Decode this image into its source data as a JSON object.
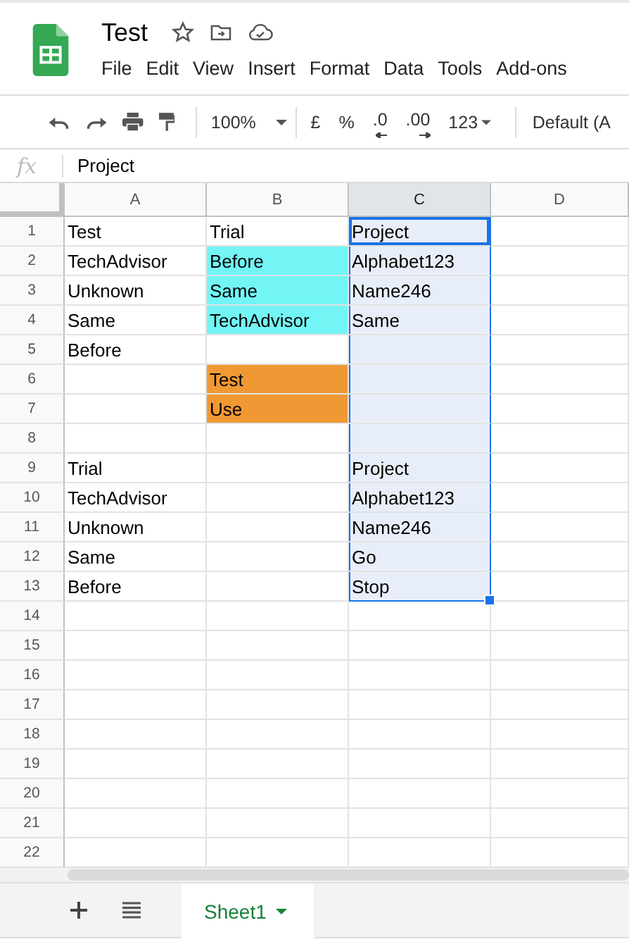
{
  "document": {
    "title": "Test"
  },
  "menu": [
    "File",
    "Edit",
    "View",
    "Insert",
    "Format",
    "Data",
    "Tools",
    "Add-ons"
  ],
  "toolbar": {
    "zoom": "100%",
    "currency": "£",
    "percent": "%",
    "decrease_decimal": ".0",
    "increase_decimal": ".00",
    "more_formats": "123",
    "font": "Default (A"
  },
  "formula_bar": {
    "label": "fx",
    "value": "Project"
  },
  "columns": [
    {
      "label": "A",
      "selected": false
    },
    {
      "label": "B",
      "selected": false
    },
    {
      "label": "C",
      "selected": true
    },
    {
      "label": "D",
      "selected": false
    }
  ],
  "rows": [
    {
      "number": "1",
      "cells": [
        {
          "text": "Test"
        },
        {
          "text": "Trial"
        },
        {
          "text": "Project",
          "active": true,
          "selected": true
        },
        {}
      ]
    },
    {
      "number": "2",
      "cells": [
        {
          "text": "TechAdvisor"
        },
        {
          "text": "Before",
          "color": "#73f5f5"
        },
        {
          "text": "Alphabet123",
          "selected": true
        },
        {}
      ]
    },
    {
      "number": "3",
      "cells": [
        {
          "text": "Unknown"
        },
        {
          "text": "Same",
          "color": "#73f5f5"
        },
        {
          "text": "Name246",
          "selected": true
        },
        {}
      ]
    },
    {
      "number": "4",
      "cells": [
        {
          "text": "Same"
        },
        {
          "text": "TechAdvisor",
          "color": "#73f5f5"
        },
        {
          "text": "Same",
          "selected": true
        },
        {}
      ]
    },
    {
      "number": "5",
      "cells": [
        {
          "text": "Before"
        },
        {},
        {
          "selected": true
        },
        {}
      ]
    },
    {
      "number": "6",
      "cells": [
        {},
        {
          "text": "Test",
          "color": "#f09834"
        },
        {
          "selected": true
        },
        {}
      ]
    },
    {
      "number": "7",
      "cells": [
        {},
        {
          "text": "Use",
          "color": "#f09834"
        },
        {
          "selected": true
        },
        {}
      ]
    },
    {
      "number": "8",
      "cells": [
        {},
        {},
        {
          "selected": true
        },
        {}
      ]
    },
    {
      "number": "9",
      "cells": [
        {
          "text": "Trial"
        },
        {},
        {
          "text": "Project",
          "selected": true
        },
        {}
      ]
    },
    {
      "number": "10",
      "cells": [
        {
          "text": "TechAdvisor"
        },
        {},
        {
          "text": "Alphabet123",
          "selected": true
        },
        {}
      ]
    },
    {
      "number": "11",
      "cells": [
        {
          "text": "Unknown"
        },
        {},
        {
          "text": "Name246",
          "selected": true
        },
        {}
      ]
    },
    {
      "number": "12",
      "cells": [
        {
          "text": "Same"
        },
        {},
        {
          "text": "Go",
          "selected": true
        },
        {}
      ]
    },
    {
      "number": "13",
      "cells": [
        {
          "text": "Before"
        },
        {},
        {
          "text": "Stop",
          "selected": true
        },
        {}
      ]
    },
    {
      "number": "14",
      "cells": [
        {},
        {},
        {},
        {}
      ]
    },
    {
      "number": "15",
      "cells": [
        {},
        {},
        {},
        {}
      ]
    },
    {
      "number": "16",
      "cells": [
        {},
        {},
        {},
        {}
      ]
    },
    {
      "number": "17",
      "cells": [
        {},
        {},
        {},
        {}
      ]
    },
    {
      "number": "18",
      "cells": [
        {},
        {},
        {},
        {}
      ]
    },
    {
      "number": "19",
      "cells": [
        {},
        {},
        {},
        {}
      ]
    },
    {
      "number": "20",
      "cells": [
        {},
        {},
        {},
        {}
      ]
    },
    {
      "number": "21",
      "cells": [
        {},
        {},
        {},
        {}
      ]
    },
    {
      "number": "22",
      "cells": [
        {},
        {},
        {},
        {}
      ]
    }
  ],
  "sheets": [
    {
      "label": "Sheet1",
      "selected": true
    }
  ]
}
